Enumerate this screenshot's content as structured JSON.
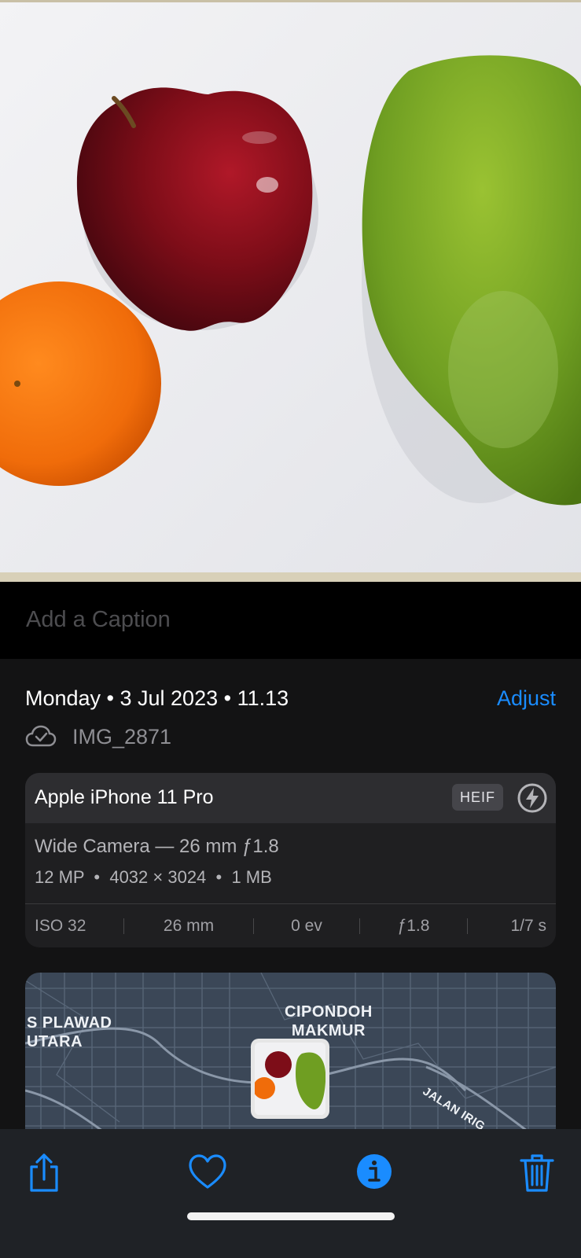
{
  "caption": {
    "placeholder": "Add a Caption"
  },
  "details": {
    "date_time": "Monday • 3 Jul 2023 • 11.13",
    "adjust_label": "Adjust",
    "file_name": "IMG_2871"
  },
  "camera": {
    "device": "Apple iPhone 11 Pro",
    "format_badge": "HEIF",
    "lens": "Wide Camera — 26 mm ƒ1.8",
    "specs": "12 MP  •  4032 × 3024  •  1 MB",
    "exif": [
      "ISO 32",
      "26 mm",
      "0 ev",
      "ƒ1.8",
      "1/7 s"
    ]
  },
  "map": {
    "labels": {
      "left": "S PLAWAD\nUTARA",
      "center": "CIPONDOH\nMAKMUR",
      "road": "JALAN IRIG"
    }
  },
  "toolbar": {
    "icons": [
      "share-icon",
      "heart-icon",
      "info-icon",
      "trash-icon"
    ]
  },
  "colors": {
    "accent": "#1a8cff",
    "background": "#000000",
    "panel": "#131314",
    "card": "#1f1f21",
    "map": "#3b4757"
  }
}
